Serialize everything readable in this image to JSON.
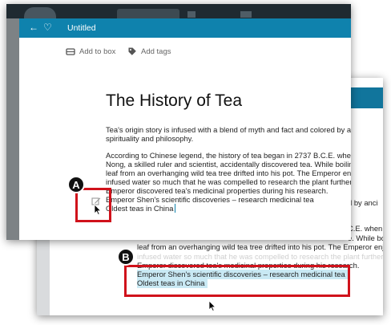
{
  "front": {
    "header": {
      "title": "Untitled"
    },
    "toolbar": {
      "add_to_box": "Add to box",
      "add_tags": "Add tags"
    },
    "doc": {
      "title": "The History of Tea",
      "p1": [
        "Tea's origin story is infused with a blend of myth and fact and colored by ancie",
        "spirituality and philosophy."
      ],
      "p2": [
        "According to Chinese legend, the history of tea began in 2737 B.C.E. when the",
        "Nong, a skilled ruler and scientist, accidentally discovered tea. While boiling w",
        "leaf from an overhanging wild tea tree drifted into his pot. The Emperor enjoy",
        "infused water so much that he  was compelled to research the plant further. L",
        "Emperor discovered tea's medicinal properties during his research.",
        "Emperor Shen's scientific discoveries – research medicinal tea",
        "Oldest teas in China"
      ]
    }
  },
  "back": {
    "right_lines": [
      "d by anci",
      "C.E. when t",
      "e. While boil"
    ],
    "lines": [
      "leaf from an overhanging wild tea tree drifted into his pot. The Emperor enjoy",
      "infused water so much that he  was compelled to research the plant further.",
      "Emperor discovered tea's medicinal properties during his research.",
      "Emperor Shen's scientific discoveries – research medicinal tea",
      "Oldest teas in China"
    ]
  },
  "annotations": {
    "a": "A",
    "b": "B"
  },
  "colors": {
    "header_blue": "#0f82ad",
    "highlight": "#c9e9f4",
    "annotation_red": "#d0121b"
  }
}
